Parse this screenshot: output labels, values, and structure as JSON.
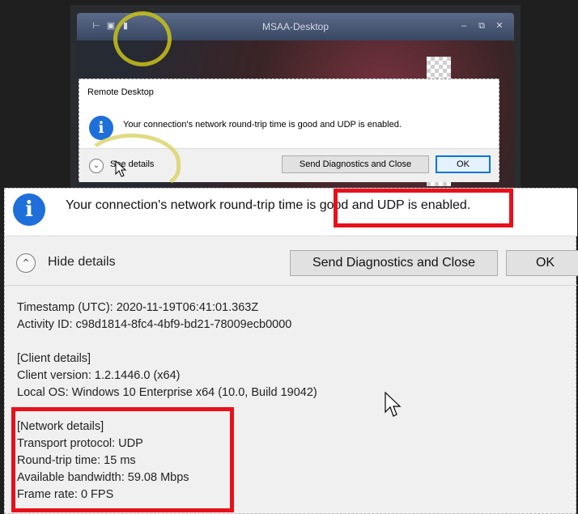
{
  "small_window": {
    "title": "MSAA-Desktop",
    "dialog_caption": "Remote Desktop",
    "message": "Your connection's network round-trip time is good and UDP is enabled.",
    "see_details_label": "See details",
    "send_button_label": "Send Diagnostics and Close",
    "ok_button_label": "OK"
  },
  "big_dialog": {
    "message": "Your connection's network round-trip time is good and UDP is enabled.",
    "hide_details_label": "Hide details",
    "send_button_label": "Send Diagnostics and Close",
    "ok_button_label": "OK",
    "details": [
      "Timestamp (UTC): 2020-11-19T06:41:01.363Z",
      "Activity ID: c98d1814-8fc4-4bf9-bd21-78009ecb0000",
      "",
      "[Client details]",
      "Client version: 1.2.1446.0 (x64)",
      "Local OS: Windows 10 Enterprise x64 (10.0, Build 19042)",
      "",
      "[Network details]",
      "Transport protocol: UDP",
      "Round-trip time: 15 ms",
      "Available bandwidth: 59.08 Mbps",
      "Frame rate: 0 FPS"
    ]
  },
  "colors": {
    "info_blue": "#1e6fd9",
    "highlight_red": "#e8101a",
    "annotation_yellow": "#c9c21a"
  },
  "icons": [
    "info-icon",
    "chevron-down-icon",
    "chevron-up-icon",
    "mouse-cursor-icon",
    "pin-icon",
    "lock-icon",
    "signal-icon",
    "minimize-icon",
    "restore-icon",
    "close-icon"
  ]
}
